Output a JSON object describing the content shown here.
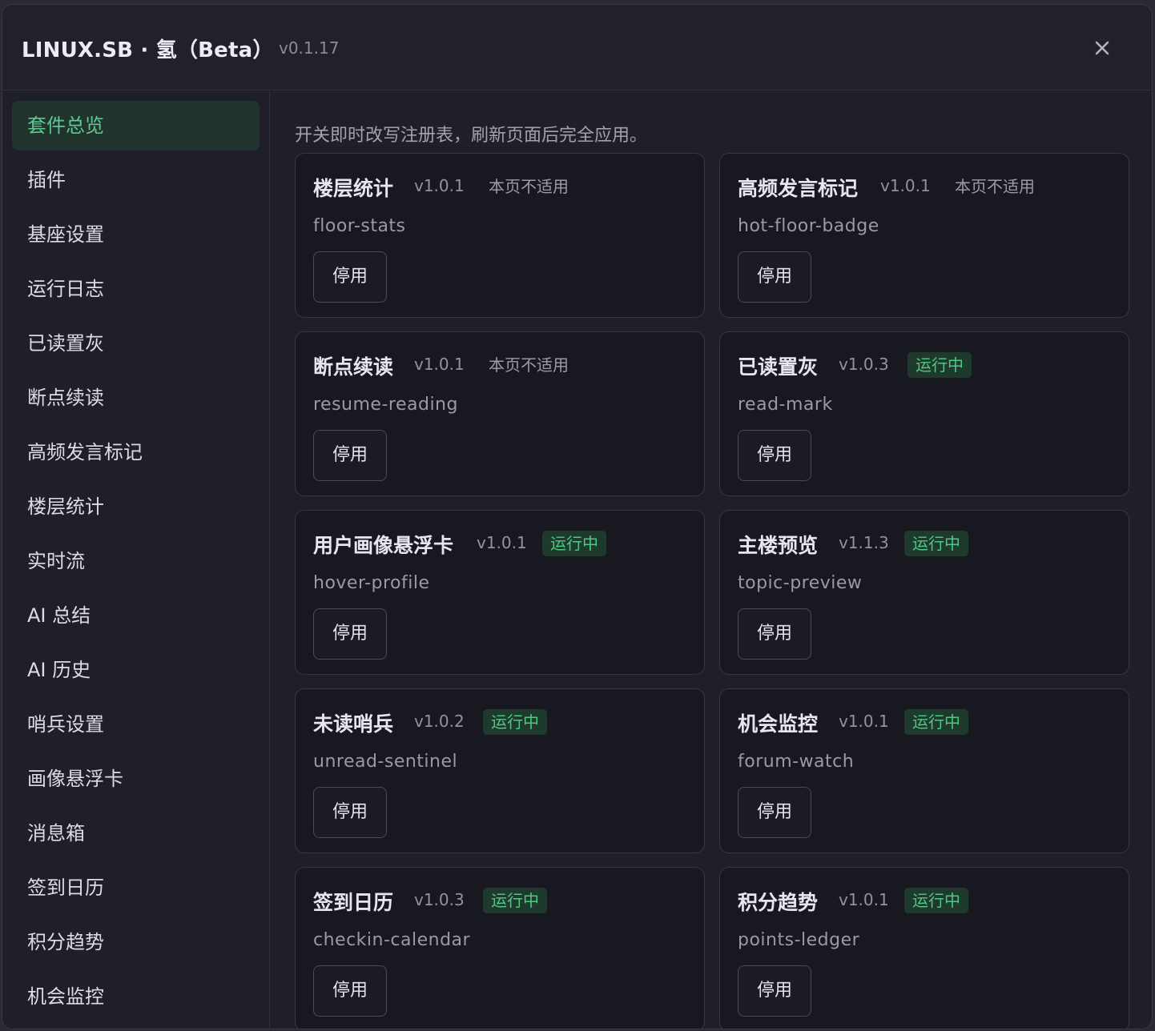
{
  "header": {
    "title": "LINUX.SB · 氢（Beta）",
    "version": "v0.1.17"
  },
  "sidebar": {
    "items": [
      {
        "label": "套件总览",
        "active": true
      },
      {
        "label": "插件"
      },
      {
        "label": "基座设置"
      },
      {
        "label": "运行日志"
      },
      {
        "label": "已读置灰"
      },
      {
        "label": "断点续读"
      },
      {
        "label": "高频发言标记"
      },
      {
        "label": "楼层统计"
      },
      {
        "label": "实时流"
      },
      {
        "label": "AI 总结"
      },
      {
        "label": "AI 历史"
      },
      {
        "label": "哨兵设置"
      },
      {
        "label": "画像悬浮卡"
      },
      {
        "label": "消息箱"
      },
      {
        "label": "签到日历"
      },
      {
        "label": "积分趋势"
      },
      {
        "label": "机会监控"
      }
    ]
  },
  "main": {
    "hint": "开关即时改写注册表，刷新页面后完全应用。",
    "cards": [
      {
        "name": "楼层统计",
        "version": "v1.0.1",
        "status": "本页不适用",
        "running": false,
        "id": "floor-stats",
        "button": "停用"
      },
      {
        "name": "高频发言标记",
        "version": "v1.0.1",
        "status": "本页不适用",
        "running": false,
        "id": "hot-floor-badge",
        "button": "停用"
      },
      {
        "name": "断点续读",
        "version": "v1.0.1",
        "status": "本页不适用",
        "running": false,
        "id": "resume-reading",
        "button": "停用"
      },
      {
        "name": "已读置灰",
        "version": "v1.0.3",
        "status": "运行中",
        "running": true,
        "id": "read-mark",
        "button": "停用"
      },
      {
        "name": "用户画像悬浮卡",
        "version": "v1.0.1",
        "status": "运行中",
        "running": true,
        "id": "hover-profile",
        "button": "停用"
      },
      {
        "name": "主楼预览",
        "version": "v1.1.3",
        "status": "运行中",
        "running": true,
        "id": "topic-preview",
        "button": "停用"
      },
      {
        "name": "未读哨兵",
        "version": "v1.0.2",
        "status": "运行中",
        "running": true,
        "id": "unread-sentinel",
        "button": "停用"
      },
      {
        "name": "机会监控",
        "version": "v1.0.1",
        "status": "运行中",
        "running": true,
        "id": "forum-watch",
        "button": "停用"
      },
      {
        "name": "签到日历",
        "version": "v1.0.3",
        "status": "运行中",
        "running": true,
        "id": "checkin-calendar",
        "button": "停用"
      },
      {
        "name": "积分趋势",
        "version": "v1.0.1",
        "status": "运行中",
        "running": true,
        "id": "points-ledger",
        "button": "停用"
      }
    ]
  },
  "icons": {
    "close": "close-icon"
  },
  "colors": {
    "accent": "#5dc893",
    "running_bg": "#1d3a2c",
    "running_text": "#4fc884",
    "window_bg": "#1f1f29",
    "card_bg": "#181821"
  }
}
